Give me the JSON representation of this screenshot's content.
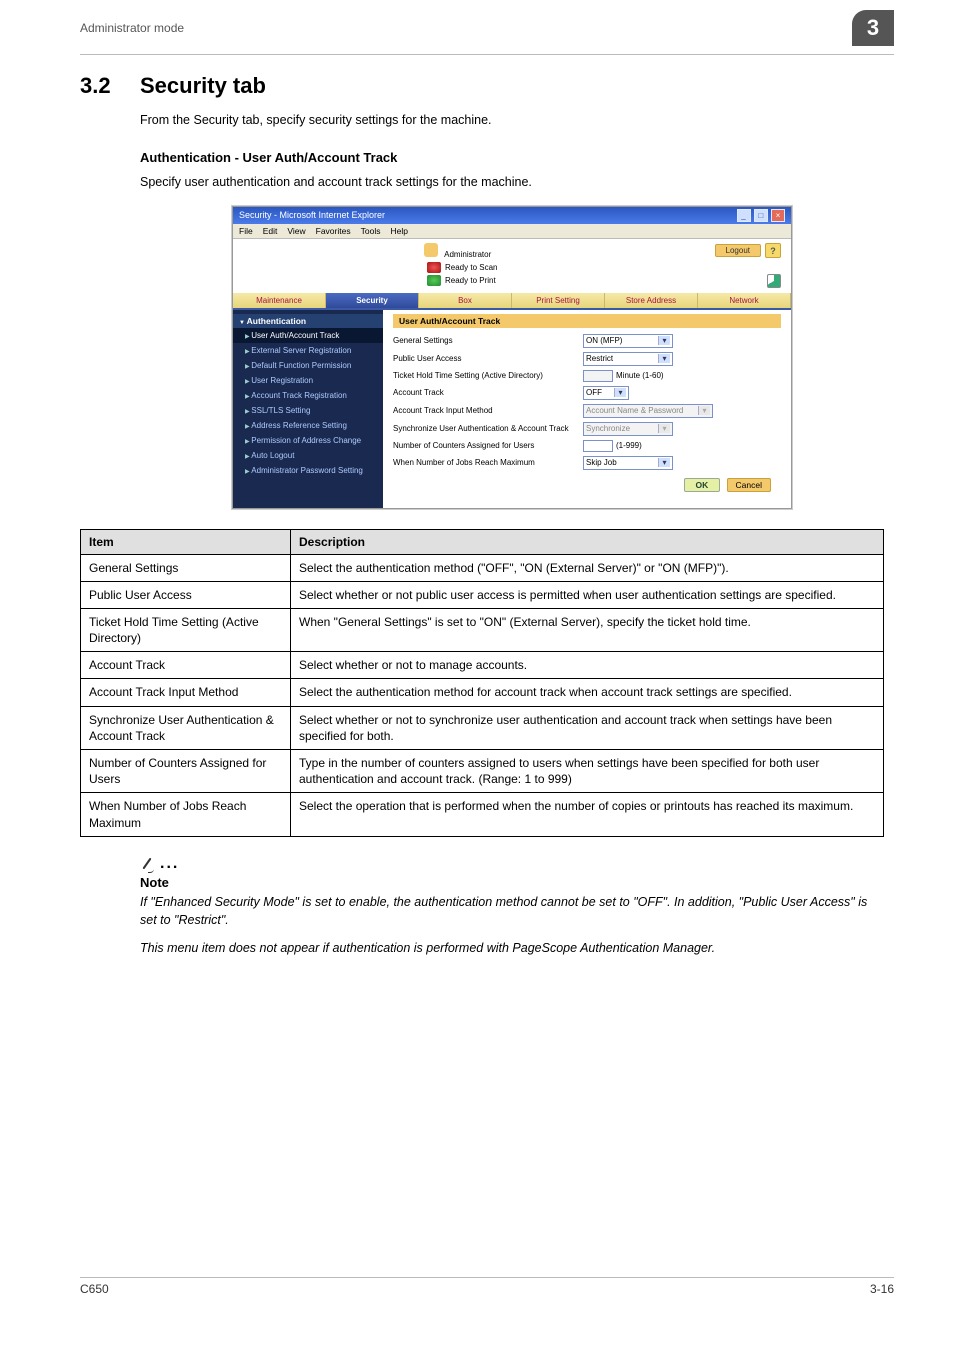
{
  "header": {
    "running_head": "Administrator mode",
    "chapter_badge": "3"
  },
  "section": {
    "number": "3.2",
    "title": "Security tab"
  },
  "intro": "From the Security tab, specify security settings for the machine.",
  "sub": {
    "heading": "Authentication - User Auth/Account Track",
    "intro": "Specify user authentication and account track settings for the machine."
  },
  "screenshot": {
    "window_title": "Security - Microsoft Internet Explorer",
    "menubar": [
      "File",
      "Edit",
      "View",
      "Favorites",
      "Tools",
      "Help"
    ],
    "admin_label": "Administrator",
    "logout": "Logout",
    "help": "?",
    "status": {
      "scan": "Ready to Scan",
      "print": "Ready to Print"
    },
    "tabs": [
      "Maintenance",
      "Security",
      "Box",
      "Print Setting",
      "Store Address",
      "Network"
    ],
    "active_tab": "Security",
    "nav": {
      "header": "Authentication",
      "items": [
        "User Auth/Account Track",
        "External Server Registration",
        "Default Function Permission",
        "User Registration",
        "Account Track Registration",
        "SSL/TLS Setting",
        "Address Reference Setting",
        "Permission of Address Change",
        "Auto Logout",
        "Administrator Password Setting"
      ],
      "selected": "User Auth/Account Track"
    },
    "panel_title": "User Auth/Account Track",
    "form": {
      "general_settings": {
        "label": "General Settings",
        "value": "ON (MFP)"
      },
      "public_user_access": {
        "label": "Public User Access",
        "value": "Restrict"
      },
      "ticket_hold": {
        "label": "Ticket Hold Time Setting (Active Directory)",
        "value": "",
        "suffix": "Minute (1-60)"
      },
      "account_track": {
        "label": "Account Track",
        "value": "OFF"
      },
      "input_method": {
        "label": "Account Track Input Method",
        "value": "Account Name & Password"
      },
      "sync": {
        "label": "Synchronize User Authentication & Account Track",
        "value": "Synchronize"
      },
      "counters": {
        "label": "Number of Counters Assigned for Users",
        "value": "",
        "suffix": "(1-999)"
      },
      "max_jobs": {
        "label": "When Number of Jobs Reach Maximum",
        "value": "Skip Job"
      }
    },
    "buttons": {
      "ok": "OK",
      "cancel": "Cancel"
    }
  },
  "desc_table": {
    "head": [
      "Item",
      "Description"
    ],
    "rows": [
      [
        "General Settings",
        "Select the authentication method (\"OFF\", \"ON (External Server)\" or \"ON (MFP)\")."
      ],
      [
        "Public User Access",
        "Select whether or not public user access is permitted when user authentication settings are specified."
      ],
      [
        "Ticket Hold Time Setting (Active Directory)",
        "When \"General Settings\" is set to \"ON\" (External Server), specify the ticket hold time."
      ],
      [
        "Account Track",
        "Select whether or not to manage accounts."
      ],
      [
        "Account Track Input Method",
        "Select the authentication method for account track when account track settings are specified."
      ],
      [
        "Synchronize User Authentication & Account Track",
        "Select whether or not to synchronize user authentication and account track when settings have been specified for both."
      ],
      [
        "Number of Counters Assigned for Users",
        "Type in the number of counters assigned to users when settings have been specified for both user authentication and account track. (Range: 1 to 999)"
      ],
      [
        "When Number of Jobs Reach Maximum",
        "Select the operation that is performed when the number of copies or printouts has reached its maximum."
      ]
    ]
  },
  "note": {
    "label": "Note",
    "p1": "If \"Enhanced Security Mode\" is set to enable, the authentication method cannot be set to \"OFF\". In addition, \"Public User Access\" is set to \"Restrict\".",
    "p2": "This menu item does not appear if authentication is performed with PageScope Authentication Manager."
  },
  "footer": {
    "left": "C650",
    "right": "3-16"
  }
}
